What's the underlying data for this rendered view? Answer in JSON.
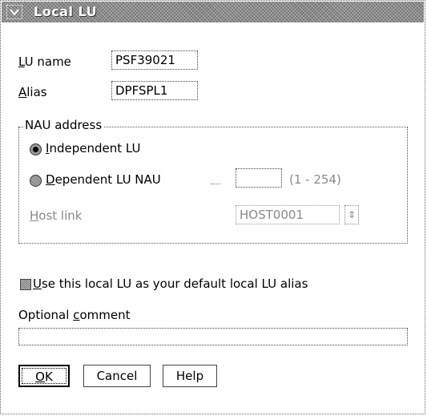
{
  "window": {
    "title": "Local LU"
  },
  "lu_name": {
    "label_prefix": "",
    "label_mnemonic": "L",
    "label_rest": "U name",
    "value": "PSF39021"
  },
  "alias": {
    "label_mnemonic": "A",
    "label_rest": "lias",
    "value": "DPFSPL1"
  },
  "nau_group": {
    "title": "NAU address",
    "independent": {
      "label_mnemonic": "I",
      "label_rest": "ndependent LU",
      "selected": true
    },
    "dependent": {
      "label_mnemonic": "D",
      "label_rest": "ependent LU NAU",
      "value": "",
      "range": "(1 - 254)",
      "selected": false
    },
    "host_link": {
      "label_mnemonic": "H",
      "label_rest": "ost link",
      "value": "HOST0001"
    }
  },
  "default_checkbox": {
    "label_mnemonic": "U",
    "label_rest": "se this local LU as your default local LU alias",
    "checked": false
  },
  "comment": {
    "label_prefix": "Optional ",
    "label_mnemonic": "c",
    "label_rest": "omment",
    "value": ""
  },
  "buttons": {
    "ok": {
      "mnemonic": "O",
      "rest": "K"
    },
    "cancel": {
      "label": "Cancel"
    },
    "help": {
      "label": "Help"
    }
  }
}
